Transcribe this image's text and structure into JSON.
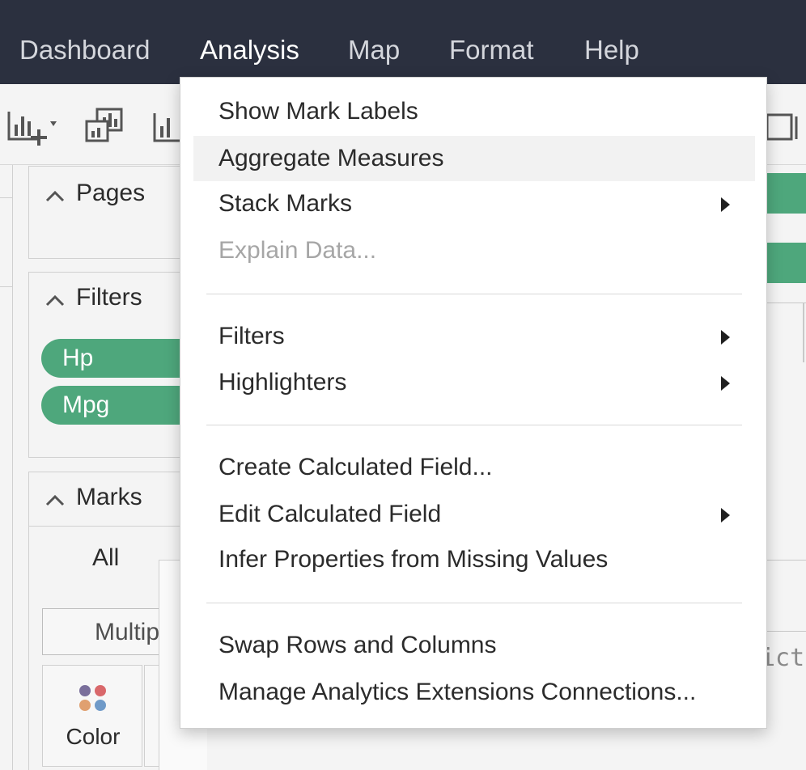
{
  "menubar": {
    "items": [
      "Dashboard",
      "Analysis",
      "Map",
      "Format",
      "Help"
    ],
    "active": "Analysis"
  },
  "left_panel": {
    "pages": {
      "title": "Pages"
    },
    "filters": {
      "title": "Filters",
      "pills": [
        "Hp",
        "Mpg"
      ]
    },
    "marks": {
      "title": "Marks",
      "all_label": "All",
      "mark_type": "Multip",
      "color_label": "Color"
    }
  },
  "background_text": {
    "right_fragment": "ict"
  },
  "analysis_menu": {
    "groups": [
      [
        {
          "label": "Show Mark Labels",
          "submenu": false,
          "disabled": false,
          "highlighted": false
        },
        {
          "label": "Aggregate Measures",
          "submenu": false,
          "disabled": false,
          "highlighted": true
        },
        {
          "label": "Stack Marks",
          "submenu": true,
          "disabled": false,
          "highlighted": false
        },
        {
          "label": "Explain Data...",
          "submenu": false,
          "disabled": true,
          "highlighted": false
        }
      ],
      [
        {
          "label": "Filters",
          "submenu": true,
          "disabled": false,
          "highlighted": false
        },
        {
          "label": "Highlighters",
          "submenu": true,
          "disabled": false,
          "highlighted": false
        }
      ],
      [
        {
          "label": "Create Calculated Field...",
          "submenu": false,
          "disabled": false,
          "highlighted": false
        },
        {
          "label": "Edit Calculated Field",
          "submenu": true,
          "disabled": false,
          "highlighted": false
        },
        {
          "label": "Infer Properties from Missing Values",
          "submenu": false,
          "disabled": false,
          "highlighted": false
        }
      ],
      [
        {
          "label": "Swap Rows and Columns",
          "submenu": false,
          "disabled": false,
          "highlighted": false
        },
        {
          "label": "Manage Analytics Extensions Connections...",
          "submenu": false,
          "disabled": false,
          "highlighted": false
        }
      ]
    ]
  },
  "colors": {
    "menubar_bg": "#2b303f",
    "pill_green": "#4ea77c",
    "menu_highlight": "#f2f2f2",
    "disabled_text": "#a6a6a6"
  },
  "icons": [
    "new-worksheet-icon",
    "new-dashboard-icon",
    "new-story-icon",
    "presentation-mode-icon"
  ]
}
